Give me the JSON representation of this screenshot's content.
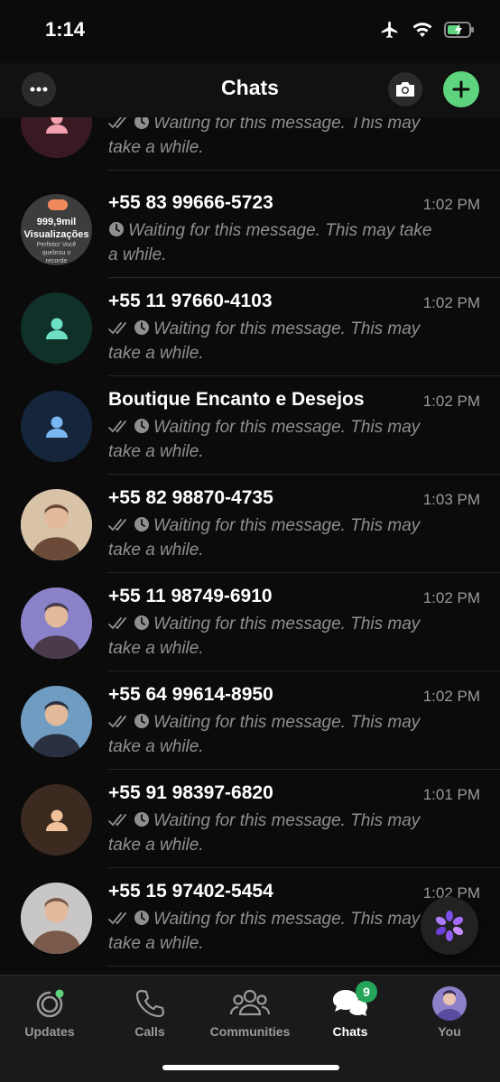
{
  "status_bar": {
    "time": "1:14"
  },
  "header": {
    "title": "Chats"
  },
  "chats": [
    {
      "name": "",
      "time": "",
      "preview": "Waiting for this message. This may take a while.",
      "ticks": true,
      "avatar": "default",
      "avatar_color": "#f2a1ae",
      "avatar_bg": "#3a1a22"
    },
    {
      "name": "+55 83 99666-5723",
      "time": "1:02 PM",
      "preview": "Waiting for this message. This may take a while.",
      "ticks": false,
      "avatar": "photo-text",
      "avatar_text_1": "999,9mil",
      "avatar_text_2": "Visualizações",
      "avatar_text_3": "Perfeito! Você quebrou o recorde",
      "avatar_bg": "#3d3d3d"
    },
    {
      "name": "+55 11 97660-4103",
      "time": "1:02 PM",
      "preview": "Waiting for this message. This may take a while.",
      "ticks": true,
      "avatar": "default",
      "avatar_color": "#6ee0c4",
      "avatar_bg": "#10302a"
    },
    {
      "name": "Boutique Encanto e Desejos",
      "time": "1:02 PM",
      "preview": "Waiting for this message. This may take a while.",
      "ticks": true,
      "avatar": "default",
      "avatar_color": "#7bb6f0",
      "avatar_bg": "#14253c"
    },
    {
      "name": "+55 82 98870-4735",
      "time": "1:03 PM",
      "preview": "Waiting for this message. This may take a while.",
      "ticks": true,
      "avatar": "photo",
      "avatar_bg": "#d9c3a8",
      "avatar_accent": "#6b4a3a"
    },
    {
      "name": "+55 11 98749-6910",
      "time": "1:02 PM",
      "preview": "Waiting for this message. This may take a while.",
      "ticks": true,
      "avatar": "photo",
      "avatar_bg": "#8a82c9",
      "avatar_accent": "#4a3a4a"
    },
    {
      "name": "+55 64 99614-8950",
      "time": "1:02 PM",
      "preview": "Waiting for this message. This may take a while.",
      "ticks": true,
      "avatar": "photo",
      "avatar_bg": "#6f9cc0",
      "avatar_accent": "#2a3040"
    },
    {
      "name": "+55 91 98397-6820",
      "time": "1:01 PM",
      "preview": "Waiting for this message. This may take a while.",
      "ticks": true,
      "avatar": "default",
      "avatar_color": "#f2c29a",
      "avatar_bg": "#3a2a20"
    },
    {
      "name": "+55 15 97402-5454",
      "time": "1:02 PM",
      "preview": "Waiting for this message. This may take a while.",
      "ticks": true,
      "avatar": "photo",
      "avatar_bg": "#c9c6c6",
      "avatar_accent": "#7a5a4a"
    }
  ],
  "tabs": [
    {
      "label": "Updates",
      "icon": "updates-icon"
    },
    {
      "label": "Calls",
      "icon": "calls-icon"
    },
    {
      "label": "Communities",
      "icon": "communities-icon"
    },
    {
      "label": "Chats",
      "icon": "chats-icon",
      "badge": "9",
      "active": true
    },
    {
      "label": "You",
      "icon": "profile-avatar"
    }
  ],
  "colors": {
    "accent": "#5fd47e",
    "badge": "#25a55a",
    "background": "#0b0b0b"
  }
}
